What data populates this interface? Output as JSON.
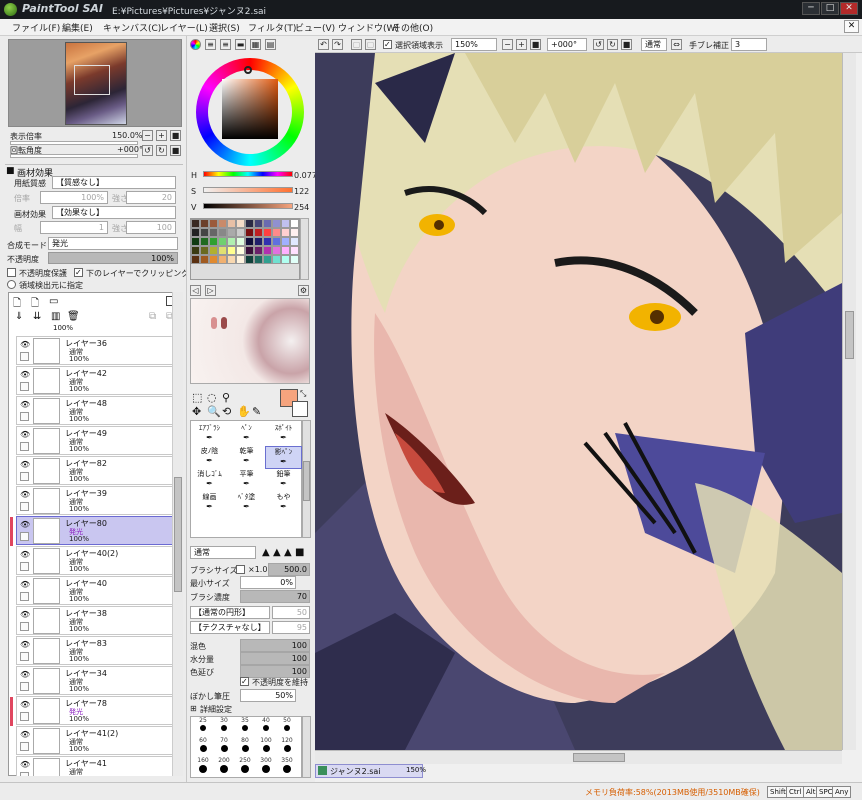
{
  "window": {
    "app_name": "PaintTool SAI",
    "title": "E:¥Pictures¥Pictures¥ジャンヌ2.sai",
    "min": "─",
    "max": "□",
    "close": "✕"
  },
  "menu": {
    "items": [
      "ファイル(F)",
      "編集(E)",
      "キャンバス(C)",
      "レイヤー(L)",
      "選択(S)",
      "フィルタ(T)",
      "ビュー(V)",
      "ウィンドウ(W)",
      "その他(O)"
    ]
  },
  "navigator": {
    "zoom_label": "表示倍率",
    "zoom_value": "150.0%",
    "angle_label": "回転角度",
    "angle_value": "+000°"
  },
  "texture": {
    "header": "画材効果",
    "paper_label": "用紙質感",
    "paper_value": "【質感なし】",
    "paper_scale_label": "倍率",
    "paper_scale": "100%",
    "paper_strength_label": "強さ",
    "paper_strength": "20",
    "effect_label": "画材効果",
    "effect_value": "【効果なし】",
    "effect_width_label": "幅",
    "effect_width": "1",
    "effect_strength_label": "強さ",
    "effect_strength": "100"
  },
  "blend": {
    "mode_label": "合成モード",
    "mode_value": "発光",
    "opacity_label": "不透明度",
    "opacity_value": "100%",
    "protect_label": "不透明度保護",
    "clip_label": "下のレイヤーでクリッピング",
    "source_label": "領域検出元に指定"
  },
  "layers": {
    "top_partial": "100%",
    "items": [
      {
        "name": "レイヤー36",
        "mode": "通常",
        "opacity": "100%",
        "selected": false,
        "glow": false
      },
      {
        "name": "レイヤー42",
        "mode": "通常",
        "opacity": "100%",
        "selected": false,
        "glow": false
      },
      {
        "name": "レイヤー48",
        "mode": "通常",
        "opacity": "100%",
        "selected": false,
        "glow": false
      },
      {
        "name": "レイヤー49",
        "mode": "通常",
        "opacity": "100%",
        "selected": false,
        "glow": false
      },
      {
        "name": "レイヤー82",
        "mode": "通常",
        "opacity": "100%",
        "selected": false,
        "glow": false
      },
      {
        "name": "レイヤー39",
        "mode": "通常",
        "opacity": "100%",
        "selected": false,
        "glow": false
      },
      {
        "name": "レイヤー80",
        "mode": "発光",
        "opacity": "100%",
        "selected": true,
        "glow": true
      },
      {
        "name": "レイヤー40(2)",
        "mode": "通常",
        "opacity": "100%",
        "selected": false,
        "glow": false
      },
      {
        "name": "レイヤー40",
        "mode": "通常",
        "opacity": "100%",
        "selected": false,
        "glow": false
      },
      {
        "name": "レイヤー38",
        "mode": "通常",
        "opacity": "100%",
        "selected": false,
        "glow": false
      },
      {
        "name": "レイヤー83",
        "mode": "通常",
        "opacity": "100%",
        "selected": false,
        "glow": false
      },
      {
        "name": "レイヤー34",
        "mode": "通常",
        "opacity": "100%",
        "selected": false,
        "glow": false
      },
      {
        "name": "レイヤー78",
        "mode": "発光",
        "opacity": "100%",
        "selected": false,
        "glow": true
      },
      {
        "name": "レイヤー41(2)",
        "mode": "通常",
        "opacity": "100%",
        "selected": false,
        "glow": false
      },
      {
        "name": "レイヤー41",
        "mode": "通常",
        "opacity": "100%",
        "selected": false,
        "glow": false
      }
    ]
  },
  "color": {
    "h_label": "H",
    "h_value": "0.077",
    "s_label": "S",
    "s_value": "122",
    "v_label": "V",
    "v_value": "254",
    "current_hex": "#f6a47e",
    "swatches": [
      "#3a2a22",
      "#6b3f2a",
      "#9b5a3b",
      "#c98a6a",
      "#e8c0a6",
      "#f4dcc8",
      "#2a2a44",
      "#464678",
      "#6a6ab0",
      "#9090d0",
      "#c0c0ee",
      "#ffffff",
      "#222222",
      "#444444",
      "#666666",
      "#888888",
      "#aaaaaa",
      "#cccccc",
      "#7a1010",
      "#c02020",
      "#ff4040",
      "#ff8a8a",
      "#ffd0d0",
      "#fff0f0",
      "#103a10",
      "#206a20",
      "#30a030",
      "#70d070",
      "#b0f0b0",
      "#e0ffe0",
      "#10103a",
      "#20206a",
      "#3030b0",
      "#6070e0",
      "#a0b0ff",
      "#e0e8ff",
      "#3a3a10",
      "#6a6a20",
      "#b0b030",
      "#e0e070",
      "#ffff90",
      "#ffffe0",
      "#3a103a",
      "#6a206a",
      "#b030b0",
      "#e070e0",
      "#ffb0ff",
      "#ffe0ff",
      "#5a3010",
      "#a05a20",
      "#e08a30",
      "#f0b070",
      "#f8d8b0",
      "#fff4e0",
      "#10403a",
      "#206a60",
      "#30a090",
      "#70e0d0",
      "#b0fff0",
      "#e0fff8"
    ]
  },
  "tools": {
    "items": [
      {
        "label": "ｴｱﾌﾞﾗｼ",
        "row": 0,
        "col": 0
      },
      {
        "label": "ﾍﾟﾝ",
        "row": 0,
        "col": 1
      },
      {
        "label": "ｽﾎﾟｲﾄ",
        "row": 0,
        "col": 2
      },
      {
        "label": "皮ﾉ陰",
        "row": 1,
        "col": 0
      },
      {
        "label": "乾筆",
        "row": 1,
        "col": 1
      },
      {
        "label": "影ﾍﾟﾝ",
        "row": 1,
        "col": 2
      },
      {
        "label": "消しｺﾞﾑ",
        "row": 2,
        "col": 0
      },
      {
        "label": "平筆",
        "row": 2,
        "col": 1
      },
      {
        "label": "鉛筆",
        "row": 2,
        "col": 2
      },
      {
        "label": "線画",
        "row": 3,
        "col": 0
      },
      {
        "label": "ﾍﾞﾀ塗",
        "row": 3,
        "col": 1
      },
      {
        "label": "もや",
        "row": 3,
        "col": 2
      }
    ],
    "extra_labels": [
      "1面",
      "水彩筆",
      "ｴｱﾌﾞﾗｼ"
    ]
  },
  "brush": {
    "mode_value": "通常",
    "size_label": "ブラシサイズ",
    "size_mult": "×1.0",
    "size_value": "500.0",
    "min_size_label": "最小サイズ",
    "min_size_value": "0%",
    "density_label": "ブラシ濃度",
    "density_value": "70",
    "shape_value": "【通常の円形】",
    "shape_strength": "50",
    "texture_value": "【テクスチャなし】",
    "texture_strength": "95",
    "blend_label": "混色",
    "blend_value": "100",
    "water_label": "水分量",
    "water_value": "100",
    "stretch_label": "色延び",
    "stretch_value": "100",
    "keep_opacity_label": "不透明度を維持",
    "blur_label": "ぼかし筆圧",
    "blur_value": "50%",
    "detail_label": "詳細設定",
    "sizes": [
      "25",
      "30",
      "35",
      "40",
      "50",
      "60",
      "70",
      "80",
      "100",
      "120",
      "160",
      "200",
      "250",
      "300",
      "350"
    ]
  },
  "canvas_toolbar": {
    "selection_label": "選択領域表示",
    "zoom_value": "150%",
    "angle_value": "+000°",
    "mode_value": "通常",
    "stabilizer_label": "手ブレ補正",
    "stabilizer_value": "3"
  },
  "document_tab": {
    "name": "ジャンヌ2.sai",
    "zoom": "150%"
  },
  "status": {
    "memory": "メモリ負荷率:58%(2013MB使用/3510MB確保)",
    "keys": [
      "Shift",
      "Ctrl",
      "Alt",
      "SPC",
      "Any"
    ]
  }
}
